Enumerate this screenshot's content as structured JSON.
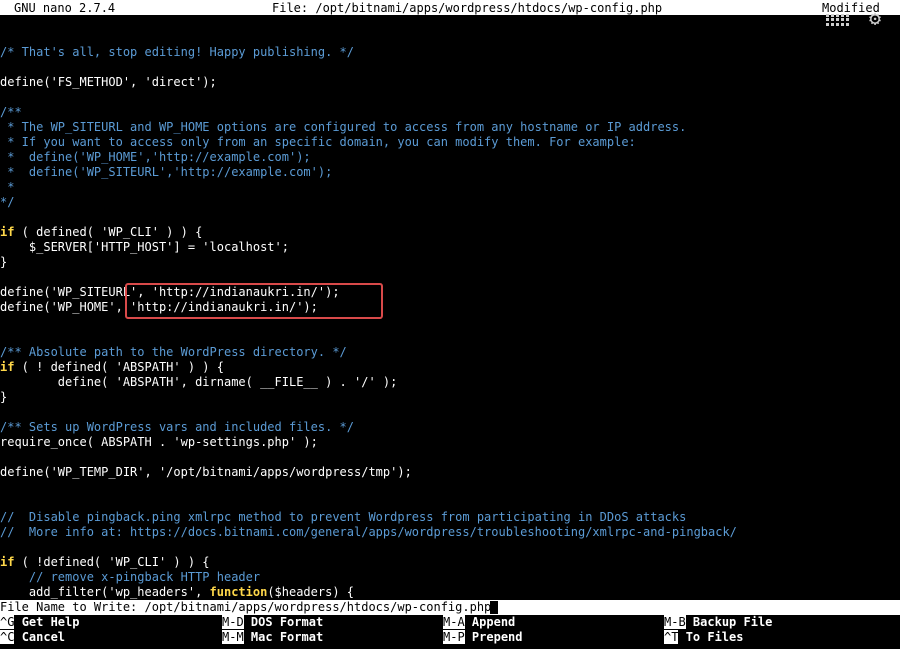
{
  "titlebar": {
    "app": "GNU nano 2.7.4",
    "file": "File: /opt/bitnami/apps/wordpress/htdocs/wp-config.php",
    "status": "Modified"
  },
  "icons": {
    "keyboard": "keyboard-icon",
    "settings": "gear-icon"
  },
  "colors": {
    "comment": "#5b9bd5",
    "keyword": "#ffd84a",
    "highlight": "#d94a4a"
  },
  "code": {
    "l1": "/* That's all, stop editing! Happy publishing. */",
    "l2": "define('FS_METHOD', 'direct');",
    "l3": "/**",
    "l4": " * The WP_SITEURL and WP_HOME options are configured to access from any hostname or IP address.",
    "l5": " * If you want to access only from an specific domain, you can modify them. For example:",
    "l6": " *  define('WP_HOME','http://example.com');",
    "l7": " *  define('WP_SITEURL','http://example.com');",
    "l8": " *",
    "l9": "*/",
    "l10a": "if",
    "l10b": " ( defined( 'WP_CLI' ) ) {",
    "l11": "    $_SERVER['HTTP_HOST'] = 'localhost';",
    "l12": "}",
    "l13": "define('WP_SITEURL', 'http://indianaukri.in/');",
    "l14": "define('WP_HOME', 'http://indianaukri.in/');",
    "l15": "/** Absolute path to the WordPress directory. */",
    "l16a": "if",
    "l16b": " ( ! defined( 'ABSPATH' ) ) {",
    "l17": "        define( 'ABSPATH', dirname( __FILE__ ) . '/' );",
    "l18": "}",
    "l19": "/** Sets up WordPress vars and included files. */",
    "l20": "require_once( ABSPATH . 'wp-settings.php' );",
    "l21": "define('WP_TEMP_DIR', '/opt/bitnami/apps/wordpress/tmp');",
    "l22": "//  Disable pingback.ping xmlrpc method to prevent Wordpress from participating in DDoS attacks",
    "l23": "//  More info at: https://docs.bitnami.com/general/apps/wordpress/troubleshooting/xmlrpc-and-pingback/",
    "l24a": "if",
    "l24b": " ( !defined( 'WP_CLI' ) ) {",
    "l25": "    // remove x-pingback HTTP header",
    "l26a": "    add_filter('wp_headers', ",
    "l26b": "function",
    "l26c": "($headers) {"
  },
  "prompt": {
    "text": "File Name to Write: /opt/bitnami/apps/wordpress/htdocs/wp-config.php"
  },
  "shortcuts": [
    {
      "key": "^G",
      "label": "Get Help"
    },
    {
      "key": "^C",
      "label": "Cancel"
    },
    {
      "key": "M-D",
      "label": "DOS Format"
    },
    {
      "key": "M-M",
      "label": "Mac Format"
    },
    {
      "key": "M-A",
      "label": "Append"
    },
    {
      "key": "M-P",
      "label": "Prepend"
    },
    {
      "key": "M-B",
      "label": "Backup File"
    },
    {
      "key": "^T",
      "label": "To Files"
    }
  ]
}
